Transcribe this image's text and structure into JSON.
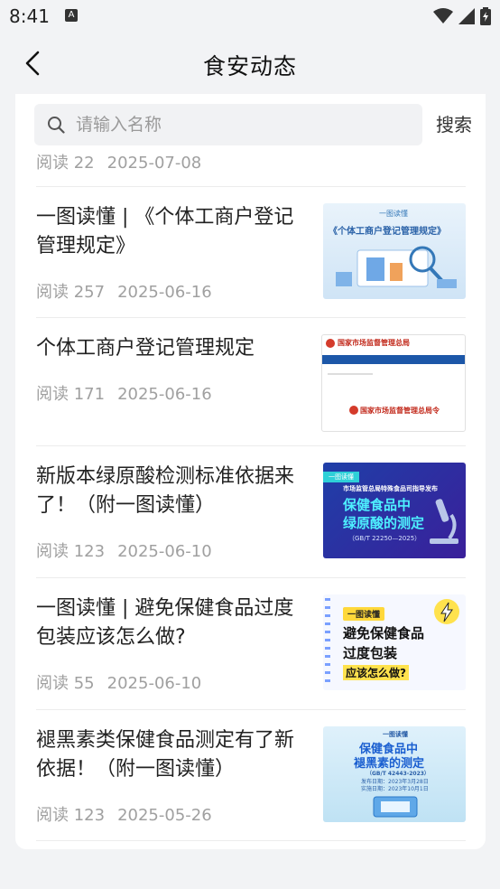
{
  "status": {
    "time": "8:41",
    "notif_icon_letter": "A"
  },
  "nav": {
    "title": "食安动态"
  },
  "search": {
    "placeholder": "请输入名称",
    "button_label": "搜索"
  },
  "partial": {
    "reads": "阅读 22",
    "date": "2025-07-08"
  },
  "articles": [
    {
      "title": "一图读懂 | 《个体工商户登记管理规定》",
      "reads": "阅读 257",
      "date": "2025-06-16",
      "thumb_lines": [
        "一图读懂",
        "《个体工商户登记管理规定》"
      ]
    },
    {
      "title": "个体工商户登记管理规定",
      "reads": "阅读 171",
      "date": "2025-06-16",
      "thumb_lines": [
        "国家市场监督管理总局",
        "国家市场监督管理总局令"
      ]
    },
    {
      "title": "新版本绿原酸检测标准依据来了！（附一图读懂）",
      "reads": "阅读 123",
      "date": "2025-06-10",
      "thumb_lines": [
        "一图读懂",
        "市场监管总局特殊食品司指导发布",
        "保健食品中",
        "绿原酸的测定",
        "（GB/T 22250—2025）"
      ]
    },
    {
      "title": "一图读懂 | 避免保健食品过度包装应该怎么做?",
      "reads": "阅读 55",
      "date": "2025-06-10",
      "thumb_lines": [
        "一图读懂",
        "避免保健食品",
        "过度包装",
        "应该怎么做?"
      ]
    },
    {
      "title": "褪黑素类保健食品测定有了新依据！（附一图读懂）",
      "reads": "阅读 123",
      "date": "2025-05-26",
      "thumb_lines": [
        "一图读懂",
        "保健食品中",
        "褪黑素的测定",
        "（GB/T 42443-2023）",
        "发布日期：2023年3月28日",
        "实施日期：2023年10月1日"
      ]
    }
  ],
  "colors": {
    "background": "#f2f3f5",
    "card": "#ffffff",
    "meta_text": "#a0a0a0"
  },
  "icons": [
    "back-arrow-icon",
    "search-icon",
    "wifi-icon",
    "signal-icon",
    "battery-icon"
  ]
}
